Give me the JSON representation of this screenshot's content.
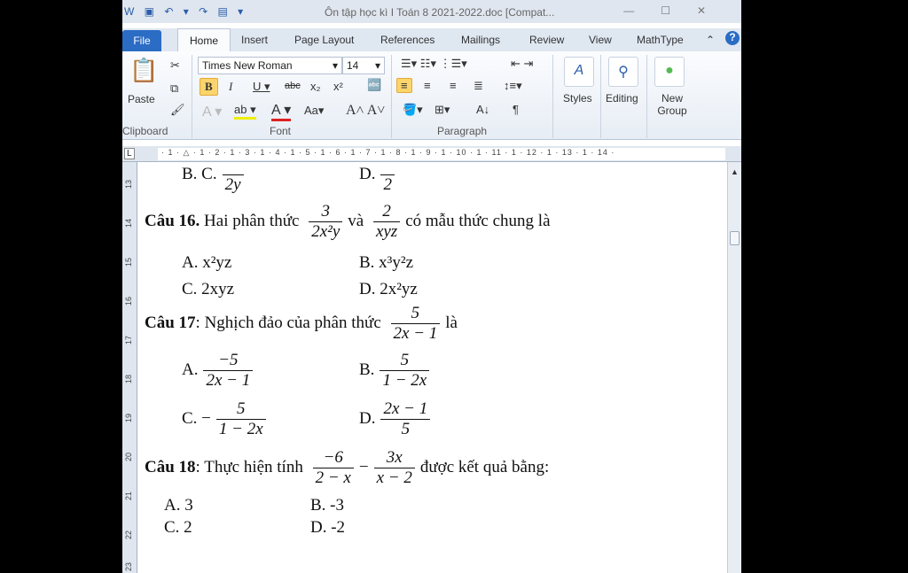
{
  "title": "Ôn tập học kì I Toán 8 2021-2022.doc [Compat...",
  "tabs": [
    "File",
    "Home",
    "Insert",
    "Page Layout",
    "References",
    "Mailings",
    "Review",
    "View",
    "MathType"
  ],
  "ribbon": {
    "paste": "Paste",
    "font_name": "Times New Roman",
    "font_size": "14",
    "styles": "Styles",
    "editing": "Editing",
    "new_group": "New Group",
    "groups": [
      "Clipboard",
      "Font",
      "Paragraph"
    ]
  },
  "ruler": "· 1 · △ · 1 · 2 · 1 · 3 · 1 · 4 · 1 · 5 · 1 · 6 · 1 · 7 · 1 · 8 · 1 · 9 · 1 · 10 · 1 · 11 · 1 · 12 · 1 · 13 · 1 · 14 ·",
  "vruler": [
    "13",
    "14",
    "15",
    "16",
    "17",
    "18",
    "19",
    "20",
    "21",
    "22",
    "23"
  ],
  "doc": {
    "prev": {
      "c_label": "B. C.",
      "c_den": "2y",
      "d_label": "D.",
      "d_den": "2"
    },
    "q16": {
      "label": "Câu 16.",
      "text1": "Hai phân thức",
      "f1n": "3",
      "f1d": "2x²y",
      "and": "và",
      "f2n": "2",
      "f2d": "xyz",
      "text2": "có mẫu thức chung là",
      "A": "A. x²yz",
      "B": "B. x³y²z",
      "C": "C. 2xyz",
      "D": "D. 2x²yz"
    },
    "q17": {
      "label": "Câu 17",
      "text1": ": Nghịch đảo của phân thức",
      "fn": "5",
      "fd": "2x − 1",
      "text2": "là",
      "A": "A.",
      "An": "−5",
      "Ad": "2x − 1",
      "B": "B.",
      "Bn": "5",
      "Bd": "1 − 2x",
      "C": "C. −",
      "Cn": "5",
      "Cd": "1 − 2x",
      "D": "D.",
      "Dn": "2x − 1",
      "Dd": "5"
    },
    "q18": {
      "label": "Câu 18",
      "text1": ": Thực hiện tính",
      "f1n": "−6",
      "f1d": "2 − x",
      "minus": "−",
      "f2n": "3x",
      "f2d": "x − 2",
      "text2": "được kết quả bằng:",
      "A": "A. 3",
      "B": "B. -3",
      "C": "C. 2",
      "D": "D. -2"
    }
  }
}
